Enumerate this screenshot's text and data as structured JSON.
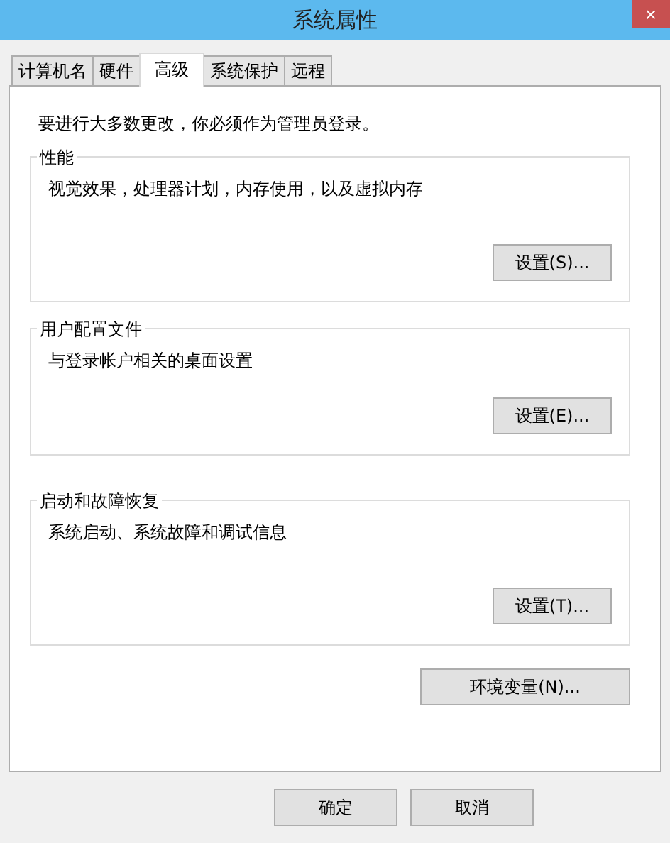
{
  "window": {
    "title": "系统属性",
    "close": "×"
  },
  "tabs": [
    {
      "label": "计算机名",
      "selected": false
    },
    {
      "label": "硬件",
      "selected": false
    },
    {
      "label": "高级",
      "selected": true
    },
    {
      "label": "系统保护",
      "selected": false
    },
    {
      "label": "远程",
      "selected": false
    }
  ],
  "notice": "要进行大多数更改，你必须作为管理员登录。",
  "groups": [
    {
      "title": "性能",
      "description": "视觉效果，处理器计划，内存使用，以及虚拟内存",
      "button": "设置(S)..."
    },
    {
      "title": "用户配置文件",
      "description": "与登录帐户相关的桌面设置",
      "button": "设置(E)..."
    },
    {
      "title": "启动和故障恢复",
      "description": "系统启动、系统故障和调试信息",
      "button": "设置(T)..."
    }
  ],
  "env_button": "环境变量(N)...",
  "buttons": [
    "确定",
    "取消"
  ]
}
